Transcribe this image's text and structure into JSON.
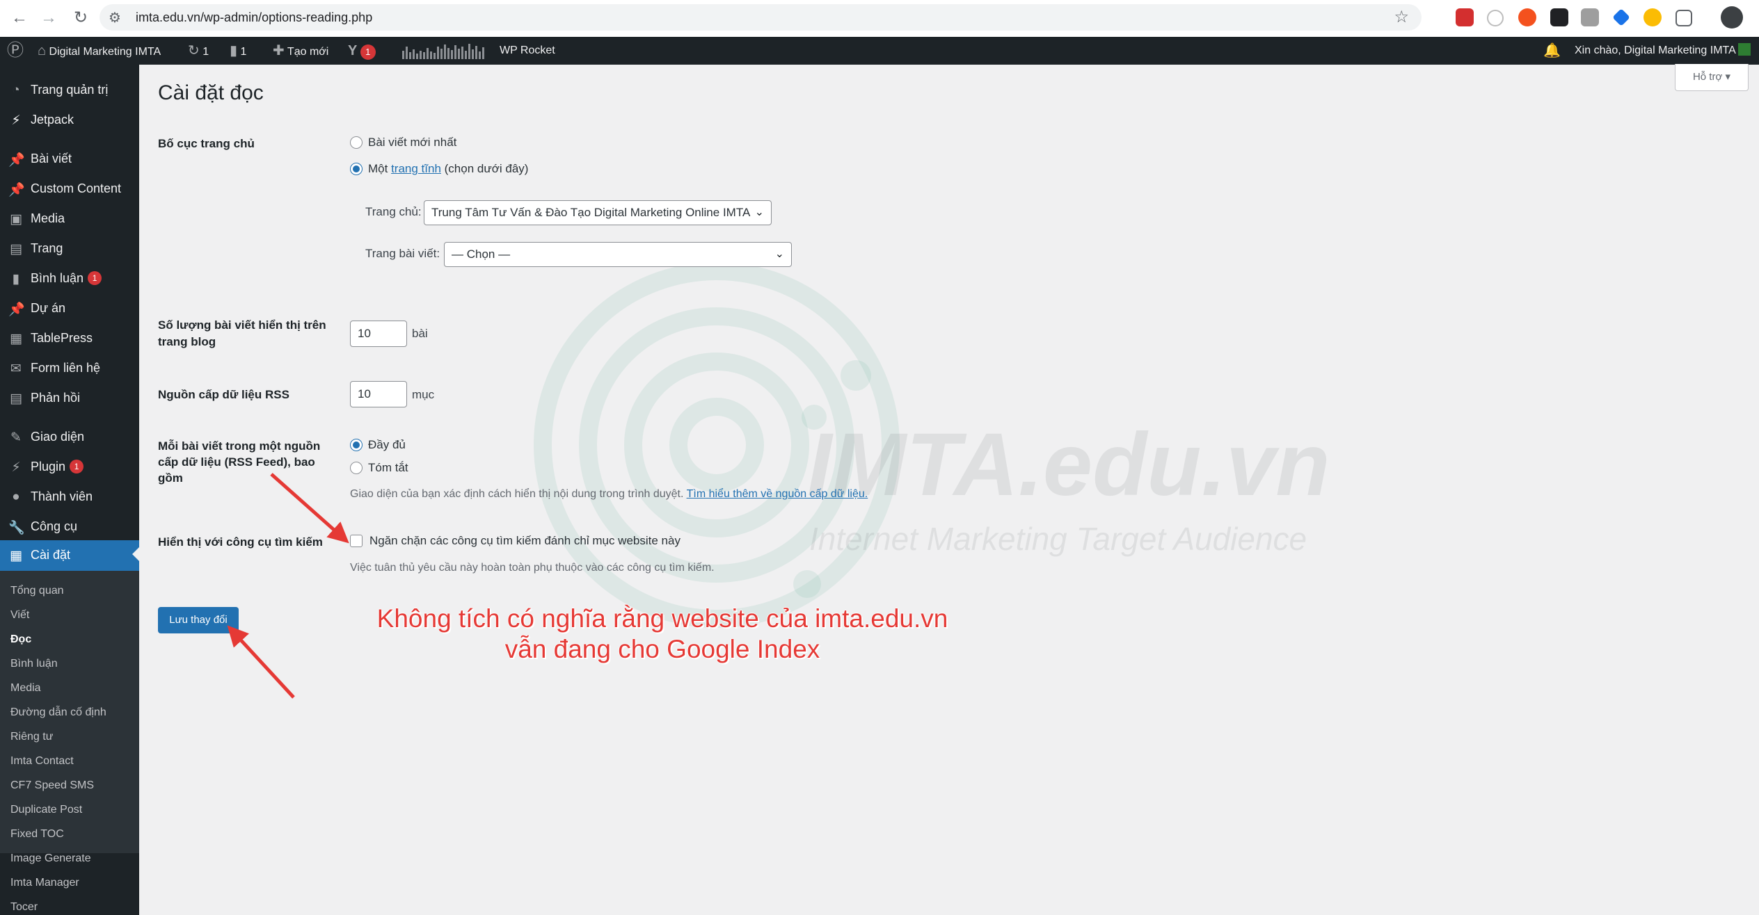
{
  "browser": {
    "url": "imta.edu.vn/wp-admin/options-reading.php",
    "icons": [
      "back-icon",
      "forward-icon",
      "reload-icon",
      "site-settings-icon",
      "bookmark-star-icon",
      "extensions-icon",
      "profile-avatar"
    ]
  },
  "adminbar": {
    "site_name": "Digital Marketing IMTA",
    "updates_count": "1",
    "comments_count": "1",
    "new_label": "Tạo mới",
    "yoast_count": "1",
    "wp_rocket": "WP Rocket",
    "greeting": "Xin chào, Digital Marketing IMTA"
  },
  "sidebar": {
    "items": [
      {
        "label": "Trang quản trị",
        "icon": "dashboard-icon"
      },
      {
        "label": "Jetpack",
        "icon": "jetpack-icon"
      },
      {
        "label": "Bài viết",
        "icon": "pin-icon"
      },
      {
        "label": "Custom Content",
        "icon": "pin-icon"
      },
      {
        "label": "Media",
        "icon": "media-icon"
      },
      {
        "label": "Trang",
        "icon": "page-icon"
      },
      {
        "label": "Bình luận",
        "icon": "comment-icon",
        "badge": "1"
      },
      {
        "label": "Dự án",
        "icon": "pin-icon"
      },
      {
        "label": "TablePress",
        "icon": "table-icon"
      },
      {
        "label": "Form liên hệ",
        "icon": "mail-icon"
      },
      {
        "label": "Phản hồi",
        "icon": "feedback-icon"
      },
      {
        "label": "Giao diện",
        "icon": "brush-icon"
      },
      {
        "label": "Plugin",
        "icon": "plugin-icon",
        "badge": "1"
      },
      {
        "label": "Thành viên",
        "icon": "user-icon"
      },
      {
        "label": "Công cụ",
        "icon": "wrench-icon"
      },
      {
        "label": "Cài đặt",
        "icon": "settings-icon"
      }
    ],
    "submenu": [
      "Tổng quan",
      "Viết",
      "Đọc",
      "Bình luận",
      "Media",
      "Đường dẫn cố định",
      "Riêng tư",
      "Imta Contact",
      "CF7 Speed SMS",
      "Duplicate Post",
      "Fixed TOC",
      "Image Generate",
      "Imta Manager",
      "Tocer"
    ],
    "submenu_active": "Đọc"
  },
  "help_tab": "Hỗ trợ",
  "page_title": "Cài đặt đọc",
  "homepage": {
    "label": "Bố cục trang chủ",
    "option_latest": "Bài viết mới nhất",
    "option_static_pre": "Một",
    "option_static_link": "trang tĩnh",
    "option_static_post": "(chọn dưới đây)",
    "front_label": "Trang chủ:",
    "front_value": "Trung Tâm Tư Vấn & Đào Tạo Digital Marketing Online IMTA",
    "posts_label": "Trang bài viết:",
    "posts_value": "— Chọn —",
    "selected": "static"
  },
  "posts_per_page": {
    "label": "Số lượng bài viết hiển thị trên trang blog",
    "value": "10",
    "unit": "bài"
  },
  "rss": {
    "label": "Nguồn cấp dữ liệu RSS",
    "value": "10",
    "unit": "mục"
  },
  "feed_content": {
    "label": "Mỗi bài viết trong một nguồn cấp dữ liệu (RSS Feed), bao gồm",
    "option_full": "Đầy đủ",
    "option_summary": "Tóm tắt",
    "selected": "full",
    "desc_pre": "Giao diện của bạn xác định cách hiển thị nội dung trong trình duyệt.",
    "desc_link": "Tìm hiểu thêm về nguồn cấp dữ liệu."
  },
  "search_visibility": {
    "label": "Hiển thị với công cụ tìm kiếm",
    "checkbox_label": "Ngăn chặn các công cụ tìm kiếm đánh chỉ mục website này",
    "checked": false,
    "desc": "Việc tuân thủ yêu cầu này hoàn toàn phụ thuộc vào các công cụ tìm kiếm."
  },
  "save_button": "Lưu thay đổi",
  "watermark": {
    "title": "IMTA.edu.vn",
    "subtitle": "Internet Marketing Target Audience"
  },
  "annotation": {
    "line1": "Không tích có nghĩa rằng website của imta.edu.vn",
    "line2": "vẫn đang cho Google Index",
    "color": "#e53935"
  }
}
